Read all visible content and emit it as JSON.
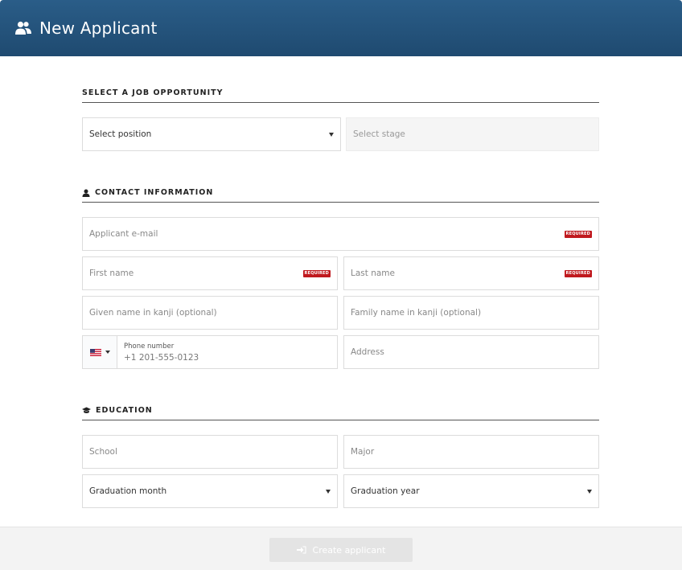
{
  "header": {
    "title": "New Applicant",
    "icon": "users-icon"
  },
  "job_section": {
    "title": "SELECT A JOB OPPORTUNITY",
    "position_placeholder": "Select position",
    "stage_placeholder": "Select stage"
  },
  "contact_section": {
    "title": "CONTACT INFORMATION",
    "icon": "user-icon",
    "email_placeholder": "Applicant e-mail",
    "first_name_placeholder": "First name",
    "last_name_placeholder": "Last name",
    "given_kanji_placeholder": "Given name in kanji (optional)",
    "family_kanji_placeholder": "Family name in kanji (optional)",
    "phone_label": "Phone number",
    "phone_placeholder": "+1 201-555-0123",
    "address_placeholder": "Address",
    "required_badge": "REQUIRED"
  },
  "education_section": {
    "title": "EDUCATION",
    "icon": "graduation-cap-icon",
    "school_placeholder": "School",
    "major_placeholder": "Major",
    "graduation_month_placeholder": "Graduation month",
    "graduation_year_placeholder": "Graduation year"
  },
  "footer": {
    "create_label": "Create applicant",
    "icon": "sign-in-icon"
  },
  "colors": {
    "header": "#1f4a70",
    "required": "#c0191e"
  }
}
